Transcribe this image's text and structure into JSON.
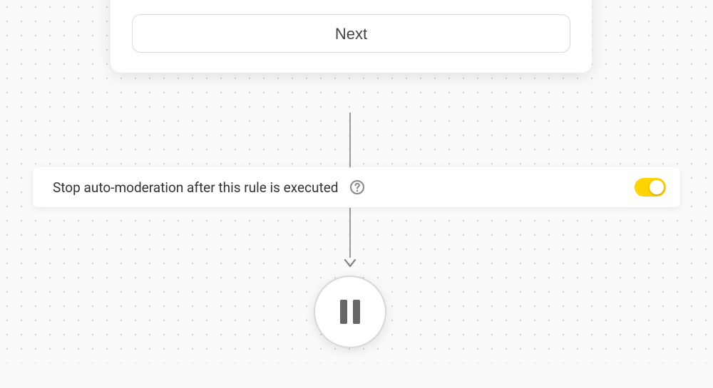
{
  "card": {
    "next_label": "Next"
  },
  "stop_row": {
    "label": "Stop auto-moderation after this rule is executed",
    "toggle_on": "true"
  },
  "colors": {
    "toggle_on": "#ffd400",
    "connector": "#9a9a9a",
    "icon_gray": "#888888"
  }
}
